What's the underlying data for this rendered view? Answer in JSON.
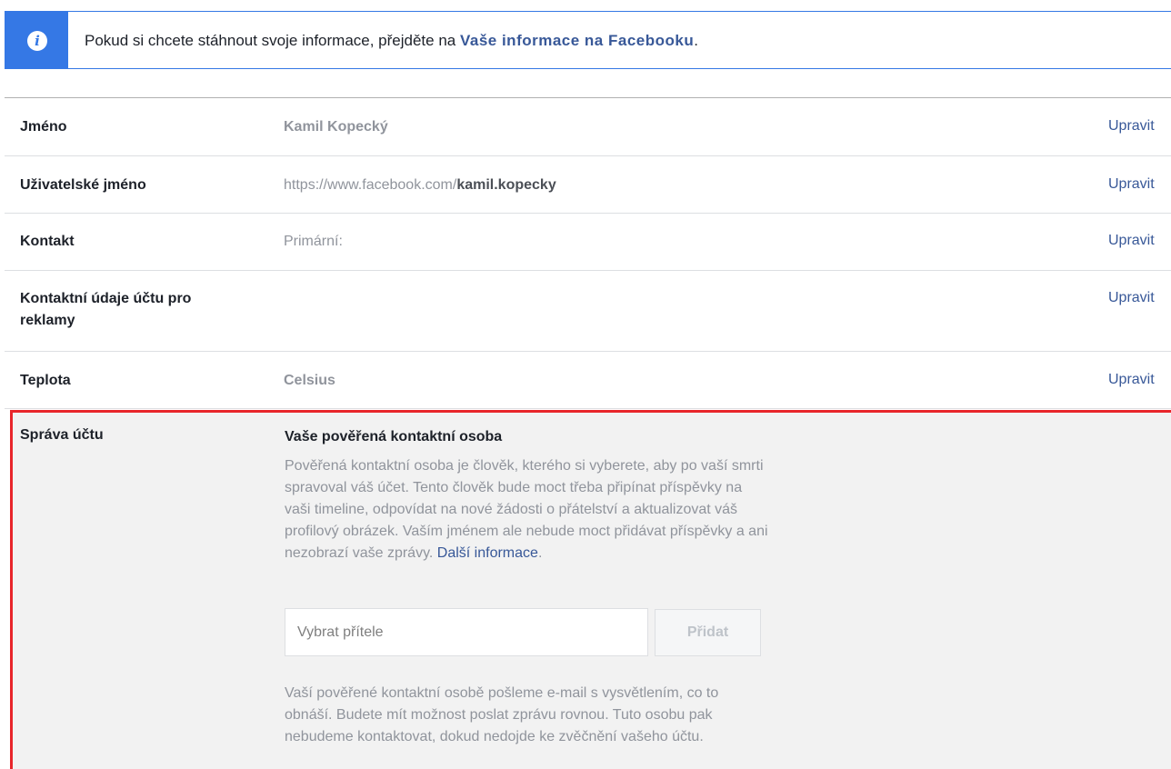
{
  "banner": {
    "icon": "info-icon",
    "text": "Pokud si chcete stáhnout svoje informace, přejděte na ",
    "link": "Vaše informace na Facebooku",
    "suffix": ".",
    "color": "#3578e5"
  },
  "rows": [
    {
      "label": "Jméno",
      "value": "Kamil Kopecký",
      "edit": "Upravit"
    },
    {
      "label": "Uživatelské jméno",
      "value_prefix": "https://www.facebook.com/",
      "value_bold": "kamil.kopecky",
      "edit": "Upravit"
    },
    {
      "label": "Kontakt",
      "value": "Primární:",
      "edit": "Upravit"
    },
    {
      "label_line1": "Kontaktní údaje účtu pro",
      "label_line2": "reklamy",
      "edit": "Upravit"
    },
    {
      "label": "Teplota",
      "value": "Celsius",
      "edit": "Upravit"
    }
  ],
  "account_management": {
    "label": "Správa účtu",
    "title": "Vaše pověřená kontaktní osoba",
    "description_lines": [
      "Pověřená kontaktní osoba je člověk, kterého si vyberete, aby po vaší smrti",
      "spravoval váš účet. Tento člověk bude moct třeba připínat příspěvky na",
      "vaši timeline, odpovídat na nové žádosti o přátelství a aktualizovat váš",
      "profilový obrázek. Vaším jménem ale nebude moct přidávat příspěvky a ani",
      "nezobrazí vaše zprávy. "
    ],
    "learn_more": "Další informace",
    "learn_more_suffix": ".",
    "input_placeholder": "Vybrat přítele",
    "add_button": "Přidat",
    "note_lines": [
      "Vaší pověřené kontaktní osobě pošleme e-mail s vysvětlením, co to",
      "obnáší. Budete mít možnost poslat zprávu rovnou. Tuto osobu pak",
      "nebudeme kontaktovat, dokud nedojde ke zvěčnění vašeho účtu."
    ],
    "highlight_color": "#e8262b"
  },
  "colors": {
    "link": "#385898",
    "muted_text": "#90949c",
    "section_bg": "#f2f2f2"
  }
}
